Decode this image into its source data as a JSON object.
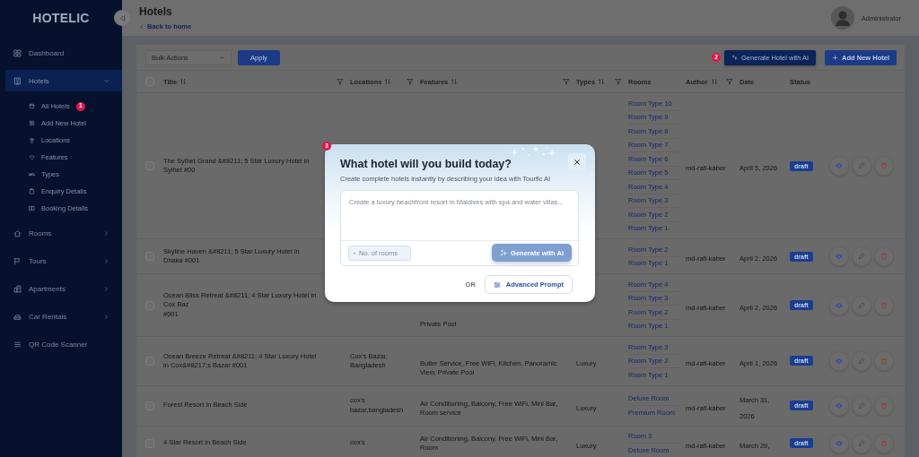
{
  "sidebar": {
    "logo": "HOTELIC",
    "items": [
      {
        "kind": "link",
        "label": "Dashboard",
        "selected": false
      },
      {
        "kind": "group",
        "label": "Hotels",
        "selected": true,
        "expanded": true,
        "children": [
          {
            "label": "All Hotels",
            "badge": "1"
          },
          {
            "label": "Add New Hotel"
          },
          {
            "label": "Locations"
          },
          {
            "label": "Features"
          },
          {
            "label": "Types"
          },
          {
            "label": "Enquiry Details"
          },
          {
            "label": "Booking Details"
          }
        ]
      },
      {
        "kind": "group",
        "label": "Rooms",
        "selected": false,
        "expanded": false
      },
      {
        "kind": "group",
        "label": "Tours",
        "selected": false,
        "expanded": false
      },
      {
        "kind": "group",
        "label": "Apartments",
        "selected": false,
        "expanded": false
      },
      {
        "kind": "group",
        "label": "Car Rentals",
        "selected": false,
        "expanded": false
      },
      {
        "kind": "link",
        "label": "QR Code Scanner",
        "selected": false
      }
    ]
  },
  "header": {
    "title": "Hotels",
    "back_link": "Back to home",
    "user": "Administrator"
  },
  "toolbar": {
    "bulk_select": "Bulk Actions",
    "apply": "Apply",
    "generate": {
      "label": "Generate Hotel with AI",
      "badge": "2"
    },
    "add": "Add New Hotel"
  },
  "table": {
    "select_all": {
      "checked": false
    },
    "columns": [
      {
        "label": "Title",
        "sortable": true,
        "filterable": true
      },
      {
        "label": "Locations",
        "sortable": true,
        "filterable": true
      },
      {
        "label": "Features",
        "sortable": true,
        "filterable": true
      },
      {
        "label": "Types",
        "sortable": true,
        "filterable": true
      },
      {
        "label": "Rooms",
        "sortable": false,
        "filterable": false
      },
      {
        "label": "Author",
        "sortable": true,
        "filterable": true
      },
      {
        "label": "Date",
        "sortable": false,
        "filterable": false
      },
      {
        "label": "Status",
        "sortable": false,
        "filterable": false
      }
    ],
    "rows": [
      {
        "checked": false,
        "title": "The Sylhet Grand &#8211; 5 Star Luxury Hotel in Sylhet #00",
        "rooms": [
          "Room Type 10",
          "Room Type 9",
          "Room Type 8",
          "Room Type 7",
          "Room Type 6",
          "Room Type 5",
          "Room Type 4",
          "Room Type 3",
          "Room Type 2",
          "Room Type 1"
        ],
        "author": "md-rafi-kaber",
        "date": "April 5, 2026",
        "status": "draft"
      },
      {
        "checked": false,
        "title": "Skyline Haven &#8211; 5 Star Luxury Hotel in Dhaka #001",
        "rooms": [
          "Room Type 2",
          "Room Type 1"
        ],
        "author": "md-rafi-kaber",
        "date": "April 2, 2026",
        "status": "draft"
      },
      {
        "checked": false,
        "title": "Ocean Bliss Retreat &#8211; 4 Star Luxury Hotel in Cox Baz\n#001",
        "features": "Private Pool",
        "rooms": [
          "Room Type 4",
          "Room Type 3",
          "Room Type 2",
          "Room Type 1"
        ],
        "author": "md-rafi-kaber",
        "date": "April 2, 2026",
        "status": "draft"
      },
      {
        "checked": false,
        "title": "Ocean Breeze Retreat &#8211; 4 Star Luxury Hotel in Cox&#8217;s Bazar #001",
        "location": "Cox's Bazar, Bangladesh",
        "features": "Butler Service, Free WiFi, Kitchen, Panoramic View, Private Pool",
        "type": "Luxury",
        "rooms": [
          "Room Type 3",
          "Room Type 2",
          "Room Type 1"
        ],
        "author": "md-rafi-kaber",
        "date": "April 1, 2026",
        "status": "draft"
      },
      {
        "checked": false,
        "title": "Forest Resort in Beach Side",
        "location": "cox's bazar,bangladesh",
        "features": "Air Conditioning, Balcony, Free WiFi, Mini Bar, Room service",
        "type": "Luxury",
        "rooms": [
          "Deluxe Room",
          "Premium Room"
        ],
        "author": "md-rafi-kaber",
        "date": "March 31,\n2026",
        "status": "draft"
      },
      {
        "checked": false,
        "title": "4 Star Resort in Beach Side",
        "location": "cox's",
        "features": "Air Conditioning, Balcony, Free WiFi, Mini Bar, Room",
        "type": "Luxury",
        "rooms": [
          "Room 3",
          "Deluxe Room"
        ],
        "author": "md-rafi-kaber",
        "date": "March 29,",
        "status": "draft"
      }
    ]
  },
  "modal": {
    "badge": "3",
    "title": "What hotel will you build today?",
    "subtitle": "Create complete hotels instantly by describing your idea with Tourfic AI",
    "prompt_placeholder": "Create a luxury beachfront resort in Maldives with spa and water villas...",
    "rooms_placeholder": "No. of rooms",
    "generate": {
      "label": "Generate with AI",
      "disabled": true
    },
    "or_label": "OR",
    "advanced": "Advanced Prompt"
  }
}
